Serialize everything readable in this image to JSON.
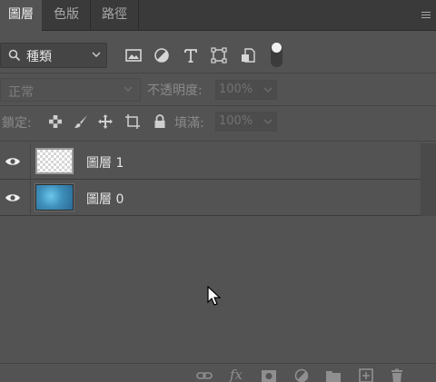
{
  "tabs": [
    {
      "label": "圖層",
      "active": true
    },
    {
      "label": "色版",
      "active": false
    },
    {
      "label": "路徑",
      "active": false
    }
  ],
  "filter": {
    "kind_label": "種類",
    "icons": [
      "image-filter-icon",
      "adjustment-filter-icon",
      "type-filter-icon",
      "shape-filter-icon",
      "smart-object-filter-icon",
      "filter-toggle"
    ]
  },
  "blend": {
    "mode": "正常",
    "opacity_label": "不透明度:",
    "opacity_value": "100%"
  },
  "lock": {
    "label": "鎖定:",
    "fill_label": "填滿:",
    "fill_value": "100%"
  },
  "layers": [
    {
      "name": "圖層 1",
      "visible": true,
      "thumbnail": "transparent"
    },
    {
      "name": "圖層 0",
      "visible": true,
      "thumbnail": "blue-texture"
    }
  ],
  "footer": {
    "fx_label": "fx",
    "icons": [
      "link-layers-icon",
      "fx-icon",
      "add-mask-icon",
      "new-adjustment-icon",
      "new-group-icon",
      "new-layer-icon",
      "delete-icon"
    ]
  },
  "colors": {
    "panel_bg": "#535353",
    "tabbar_bg": "#3a3a3a",
    "text": "#e6e6e6",
    "disabled_text": "#7d7d7d"
  }
}
